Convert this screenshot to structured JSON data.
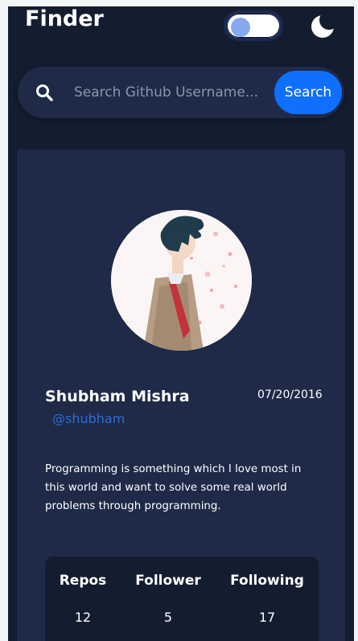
{
  "header": {
    "brand": "Finder",
    "theme_toggle": "toggle-switch",
    "theme_icon": "moon-icon"
  },
  "search": {
    "placeholder": "Search Github Username...",
    "value": "",
    "button_label": "Search"
  },
  "profile": {
    "name": "Shubham Mishra",
    "handle": "@shubham",
    "joined": "07/20/2016",
    "bio": "Programming is something which I love most in this world and want to solve some real world problems through programming."
  },
  "stats": [
    {
      "label": "Repos",
      "value": "12"
    },
    {
      "label": "Follower",
      "value": "5"
    },
    {
      "label": "Following",
      "value": "17"
    }
  ],
  "colors": {
    "page_bg": "#141d2f",
    "card_bg": "#1e2a47",
    "accent": "#0f6fff",
    "handle": "#2f6cdb"
  }
}
